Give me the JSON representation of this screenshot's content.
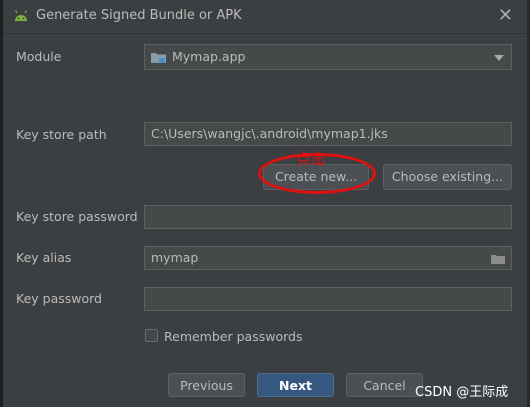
{
  "window": {
    "title": "Generate Signed Bundle or APK",
    "close_glyph": "✕"
  },
  "module": {
    "label": "Module",
    "value": "Mymap.app"
  },
  "keystore": {
    "path_label": "Key store path",
    "path_value": "C:\\Users\\wangjc\\.android\\mymap1.jks",
    "create_new": "Create new...",
    "choose_existing": "Choose existing...",
    "password_label": "Key store password",
    "password_value": ""
  },
  "key": {
    "alias_label": "Key alias",
    "alias_value": "mymap",
    "password_label": "Key password",
    "password_value": ""
  },
  "remember": {
    "label": "Remember passwords",
    "checked": false
  },
  "footer": {
    "previous": "Previous",
    "next": "Next",
    "cancel": "Cancel"
  },
  "annotation": {
    "text": "点击"
  },
  "watermark": "CSDN @王际成",
  "colors": {
    "accent": "#365880",
    "annotation": "#e01010",
    "background": "#3c3f41"
  },
  "icons": [
    "android-icon",
    "folder-icon",
    "close-icon",
    "chevron-down-icon",
    "browse-folder-icon"
  ]
}
